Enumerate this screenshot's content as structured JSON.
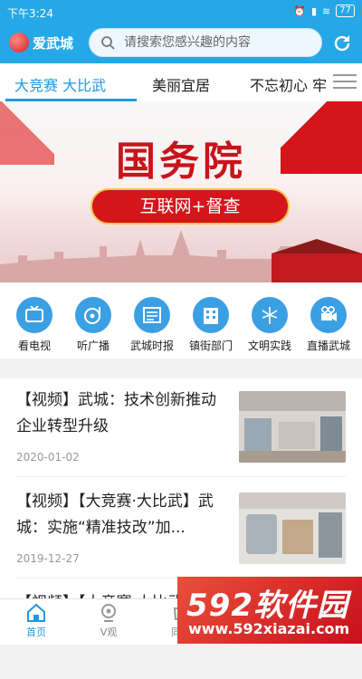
{
  "status_bar": {
    "time": "下午3:24",
    "battery": "77"
  },
  "header": {
    "logo_text": "爱武城",
    "search_placeholder": "请搜索您感兴趣的内容"
  },
  "tabs": [
    "大竞赛 大比武",
    "美丽宜居",
    "不忘初心 牢"
  ],
  "banner": {
    "title": "国务院",
    "subtitle": "互联网+督查"
  },
  "quick_links": [
    {
      "label": "看电视",
      "icon": "tv-icon"
    },
    {
      "label": "听广播",
      "icon": "radio-disc-icon"
    },
    {
      "label": "武城时报",
      "icon": "newspaper-icon"
    },
    {
      "label": "镇街部门",
      "icon": "building-icon"
    },
    {
      "label": "文明实践",
      "icon": "fireworks-icon"
    },
    {
      "label": "直播武城",
      "icon": "video-camera-icon"
    }
  ],
  "news": [
    {
      "title": "【视频】武城：技术创新推动企业转型升级",
      "date": "2020-01-02"
    },
    {
      "title": "【视频】【大竞赛·大比武】武城：实施“精准技改”加...",
      "date": "2019-12-27"
    },
    {
      "title": "【视频】【大竞赛·大比武】"
    }
  ],
  "bottom_nav": [
    "首页",
    "V观",
    "同城"
  ],
  "watermark": {
    "brand": "592软件园",
    "url": "www.592xiazai.com"
  },
  "colors": {
    "primary": "#26a8e8",
    "accent_blue": "#1f9ae0",
    "banner_red": "#c8141a"
  }
}
